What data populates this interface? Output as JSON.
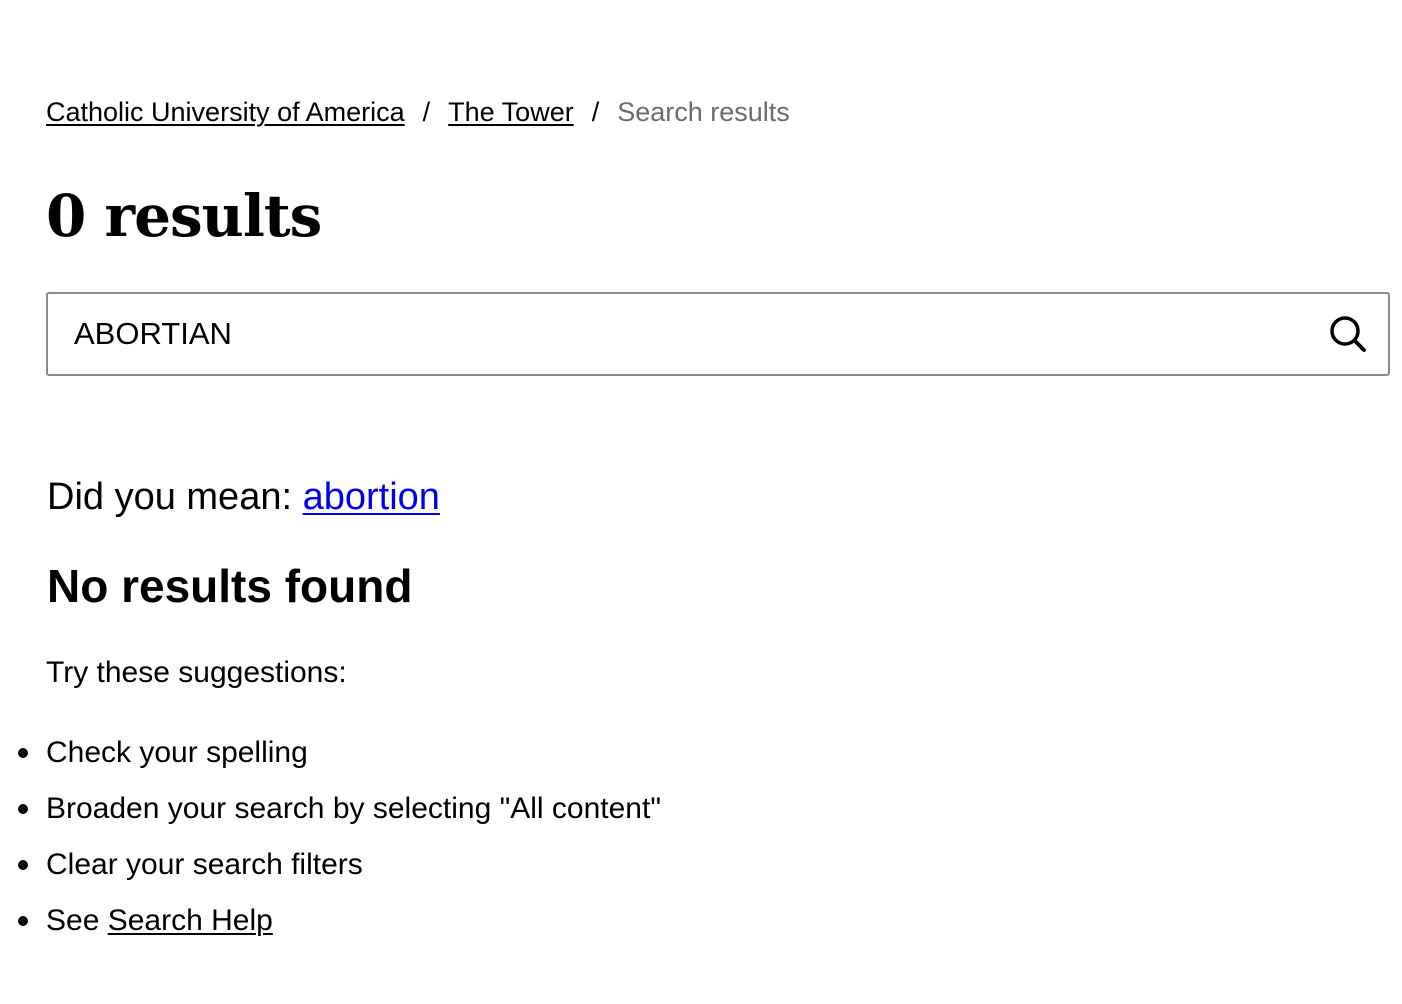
{
  "breadcrumb": {
    "items": [
      {
        "label": "Catholic University of America"
      },
      {
        "label": "The Tower"
      },
      {
        "label": "Search results"
      }
    ],
    "separator": "/"
  },
  "results": {
    "count_title": "0 results"
  },
  "search": {
    "value": "ABORTIAN",
    "icon": "search-icon"
  },
  "suggestion": {
    "prefix": "Did you mean: ",
    "term": "abortion",
    "link_color": "#0000ee"
  },
  "no_results": {
    "heading": "No results found",
    "intro": "Try these suggestions:",
    "items": [
      {
        "text": "Check your spelling"
      },
      {
        "text": "Broaden your search by selecting \"All content\""
      },
      {
        "text": "Clear your search filters"
      },
      {
        "prefix": "See ",
        "link": "Search Help"
      }
    ]
  },
  "colors": {
    "current_crumb": "#6b6b6b",
    "input_border": "#8a8a8a"
  }
}
